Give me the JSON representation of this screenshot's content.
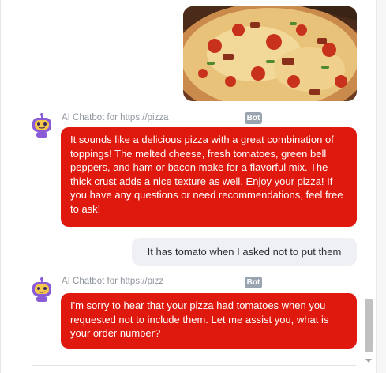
{
  "messages": [
    {
      "type": "image",
      "sender": "user",
      "image_alt": "pizza-photo"
    },
    {
      "type": "bot",
      "sender_name": "AI Chatbot for https://pizza",
      "badge": "Bot",
      "text": "It sounds like a delicious pizza with a great combination of toppings! The melted cheese, fresh tomatoes, green bell peppers, and ham or bacon make for a flavorful mix. The thick crust adds a nice texture as well. Enjoy your pizza! If you have any questions or need recommendations, feel free to ask!"
    },
    {
      "type": "user",
      "text": "It has tomato when I asked not to put them"
    },
    {
      "type": "bot",
      "sender_name": "AI Chatbot for https://pizz",
      "badge": "Bot",
      "text": "I'm sorry to hear that your pizza had tomatoes when you requested not to include them. Let me assist you, what is your order number?"
    }
  ],
  "colors": {
    "bot_bubble": "#e0190e",
    "user_bubble": "#eef0f3",
    "badge": "#9aa3b0",
    "avatar": "#8a5bd6"
  },
  "icons": {
    "avatar": "robot-avatar-icon",
    "scroll_down": "triangle-down-icon"
  }
}
